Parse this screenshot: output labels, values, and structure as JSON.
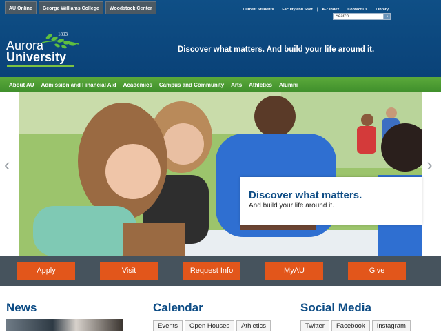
{
  "campus_tabs": [
    "AU Online",
    "George Williams College",
    "Woodstock Center"
  ],
  "utility_links": [
    "Current Students",
    "Faculty and Staff",
    "A-Z Index",
    "Contact Us",
    "Library"
  ],
  "search": {
    "placeholder": "Search"
  },
  "logo": {
    "year": "1893",
    "line1": "Aurora",
    "line2": "University"
  },
  "tagline": "Discover what matters. And build your life around it.",
  "nav": [
    "About AU",
    "Admission and Financial Aid",
    "Academics",
    "Campus and Community",
    "Arts",
    "Athletics",
    "Alumni"
  ],
  "hero": {
    "title": "Discover what matters.",
    "subtitle": "And build your life around it."
  },
  "actions": [
    "Apply",
    "Visit",
    "Request Info",
    "MyAU",
    "Give"
  ],
  "sections": {
    "news": "News",
    "calendar": {
      "title": "Calendar",
      "tabs": [
        "Events",
        "Open Houses",
        "Athletics"
      ]
    },
    "social": {
      "title": "Social Media",
      "tabs": [
        "Twitter",
        "Facebook",
        "Instagram"
      ]
    }
  },
  "colors": {
    "header": "#0a4278",
    "nav": "#4a9a32",
    "action_button": "#e2561b",
    "action_bar": "#46535d",
    "heading": "#0d4c85"
  }
}
